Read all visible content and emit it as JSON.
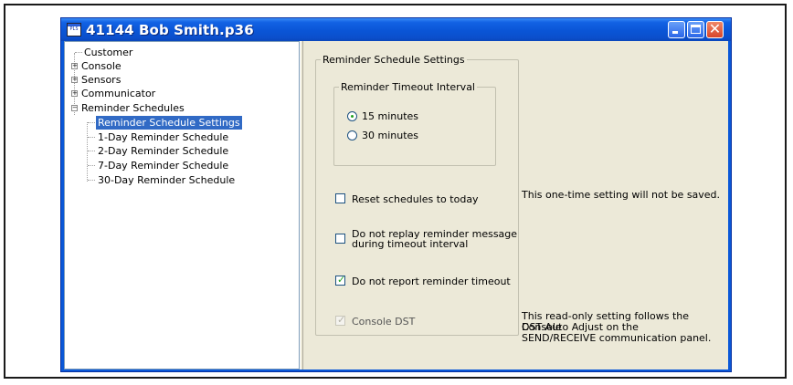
{
  "window": {
    "title": "41144 Bob Smith.p36",
    "icon": "app-icon",
    "icon_text": "PLS"
  },
  "tree": {
    "items": [
      {
        "label": "Customer",
        "expander": ""
      },
      {
        "label": "Console",
        "expander": "+"
      },
      {
        "label": "Sensors",
        "expander": "+"
      },
      {
        "label": "Communicator",
        "expander": "+"
      },
      {
        "label": "Reminder Schedules",
        "expander": "−"
      }
    ],
    "children": [
      {
        "label": "Reminder Schedule Settings",
        "selected": true
      },
      {
        "label": "1-Day Reminder Schedule",
        "selected": false
      },
      {
        "label": "2-Day Reminder Schedule",
        "selected": false
      },
      {
        "label": "7-Day Reminder Schedule",
        "selected": false
      },
      {
        "label": "30-Day Reminder Schedule",
        "selected": false
      }
    ]
  },
  "settings": {
    "group_title": "Reminder Schedule Settings",
    "timeout_group_title": "Reminder Timeout Interval",
    "timeout_options": [
      {
        "label": "15 minutes",
        "selected": true
      },
      {
        "label": "30 minutes",
        "selected": false
      }
    ],
    "reset_schedules": {
      "label": "Reset schedules to today",
      "checked": false,
      "note": "This one-time setting will not be saved."
    },
    "no_replay": {
      "label_line1": "Do not replay reminder message",
      "label_line2": "during timeout interval",
      "checked": false
    },
    "no_report": {
      "label": "Do not report reminder timeout",
      "checked": true
    },
    "console_dst": {
      "label": "Console DST",
      "checked": true,
      "disabled": true,
      "note_line1": "This read-only setting follows the Console",
      "note_line2": "DST Auto Adjust on the",
      "note_line3": "SEND/RECEIVE communication panel."
    }
  },
  "colors": {
    "selection": "#316ac5",
    "titlebar": "#0a55d6",
    "dialog": "#ece9d8",
    "check": "#21a121"
  }
}
